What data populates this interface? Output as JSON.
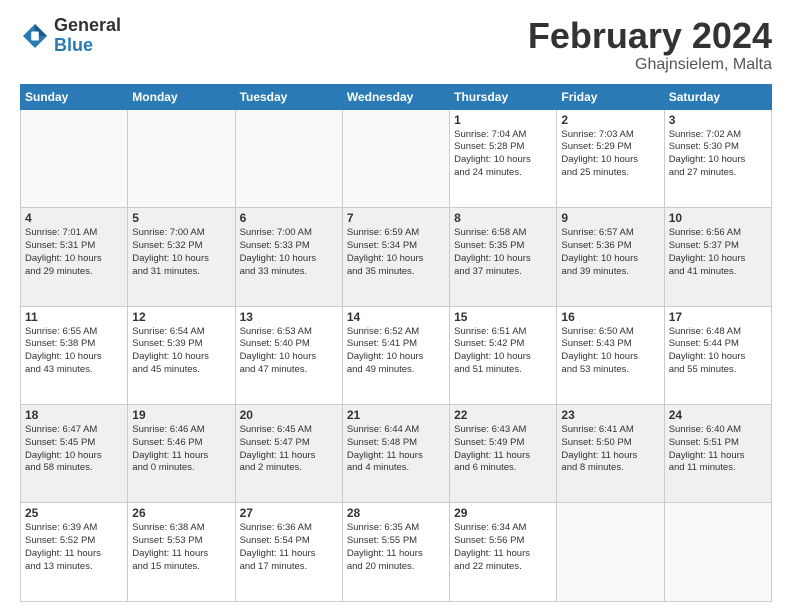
{
  "logo": {
    "general": "General",
    "blue": "Blue"
  },
  "header": {
    "month": "February 2024",
    "location": "Ghajnsielem, Malta"
  },
  "days_of_week": [
    "Sunday",
    "Monday",
    "Tuesday",
    "Wednesday",
    "Thursday",
    "Friday",
    "Saturday"
  ],
  "weeks": [
    [
      {
        "day": "",
        "info": ""
      },
      {
        "day": "",
        "info": ""
      },
      {
        "day": "",
        "info": ""
      },
      {
        "day": "",
        "info": ""
      },
      {
        "day": "1",
        "info": "Sunrise: 7:04 AM\nSunset: 5:28 PM\nDaylight: 10 hours\nand 24 minutes."
      },
      {
        "day": "2",
        "info": "Sunrise: 7:03 AM\nSunset: 5:29 PM\nDaylight: 10 hours\nand 25 minutes."
      },
      {
        "day": "3",
        "info": "Sunrise: 7:02 AM\nSunset: 5:30 PM\nDaylight: 10 hours\nand 27 minutes."
      }
    ],
    [
      {
        "day": "4",
        "info": "Sunrise: 7:01 AM\nSunset: 5:31 PM\nDaylight: 10 hours\nand 29 minutes."
      },
      {
        "day": "5",
        "info": "Sunrise: 7:00 AM\nSunset: 5:32 PM\nDaylight: 10 hours\nand 31 minutes."
      },
      {
        "day": "6",
        "info": "Sunrise: 7:00 AM\nSunset: 5:33 PM\nDaylight: 10 hours\nand 33 minutes."
      },
      {
        "day": "7",
        "info": "Sunrise: 6:59 AM\nSunset: 5:34 PM\nDaylight: 10 hours\nand 35 minutes."
      },
      {
        "day": "8",
        "info": "Sunrise: 6:58 AM\nSunset: 5:35 PM\nDaylight: 10 hours\nand 37 minutes."
      },
      {
        "day": "9",
        "info": "Sunrise: 6:57 AM\nSunset: 5:36 PM\nDaylight: 10 hours\nand 39 minutes."
      },
      {
        "day": "10",
        "info": "Sunrise: 6:56 AM\nSunset: 5:37 PM\nDaylight: 10 hours\nand 41 minutes."
      }
    ],
    [
      {
        "day": "11",
        "info": "Sunrise: 6:55 AM\nSunset: 5:38 PM\nDaylight: 10 hours\nand 43 minutes."
      },
      {
        "day": "12",
        "info": "Sunrise: 6:54 AM\nSunset: 5:39 PM\nDaylight: 10 hours\nand 45 minutes."
      },
      {
        "day": "13",
        "info": "Sunrise: 6:53 AM\nSunset: 5:40 PM\nDaylight: 10 hours\nand 47 minutes."
      },
      {
        "day": "14",
        "info": "Sunrise: 6:52 AM\nSunset: 5:41 PM\nDaylight: 10 hours\nand 49 minutes."
      },
      {
        "day": "15",
        "info": "Sunrise: 6:51 AM\nSunset: 5:42 PM\nDaylight: 10 hours\nand 51 minutes."
      },
      {
        "day": "16",
        "info": "Sunrise: 6:50 AM\nSunset: 5:43 PM\nDaylight: 10 hours\nand 53 minutes."
      },
      {
        "day": "17",
        "info": "Sunrise: 6:48 AM\nSunset: 5:44 PM\nDaylight: 10 hours\nand 55 minutes."
      }
    ],
    [
      {
        "day": "18",
        "info": "Sunrise: 6:47 AM\nSunset: 5:45 PM\nDaylight: 10 hours\nand 58 minutes."
      },
      {
        "day": "19",
        "info": "Sunrise: 6:46 AM\nSunset: 5:46 PM\nDaylight: 11 hours\nand 0 minutes."
      },
      {
        "day": "20",
        "info": "Sunrise: 6:45 AM\nSunset: 5:47 PM\nDaylight: 11 hours\nand 2 minutes."
      },
      {
        "day": "21",
        "info": "Sunrise: 6:44 AM\nSunset: 5:48 PM\nDaylight: 11 hours\nand 4 minutes."
      },
      {
        "day": "22",
        "info": "Sunrise: 6:43 AM\nSunset: 5:49 PM\nDaylight: 11 hours\nand 6 minutes."
      },
      {
        "day": "23",
        "info": "Sunrise: 6:41 AM\nSunset: 5:50 PM\nDaylight: 11 hours\nand 8 minutes."
      },
      {
        "day": "24",
        "info": "Sunrise: 6:40 AM\nSunset: 5:51 PM\nDaylight: 11 hours\nand 11 minutes."
      }
    ],
    [
      {
        "day": "25",
        "info": "Sunrise: 6:39 AM\nSunset: 5:52 PM\nDaylight: 11 hours\nand 13 minutes."
      },
      {
        "day": "26",
        "info": "Sunrise: 6:38 AM\nSunset: 5:53 PM\nDaylight: 11 hours\nand 15 minutes."
      },
      {
        "day": "27",
        "info": "Sunrise: 6:36 AM\nSunset: 5:54 PM\nDaylight: 11 hours\nand 17 minutes."
      },
      {
        "day": "28",
        "info": "Sunrise: 6:35 AM\nSunset: 5:55 PM\nDaylight: 11 hours\nand 20 minutes."
      },
      {
        "day": "29",
        "info": "Sunrise: 6:34 AM\nSunset: 5:56 PM\nDaylight: 11 hours\nand 22 minutes."
      },
      {
        "day": "",
        "info": ""
      },
      {
        "day": "",
        "info": ""
      }
    ]
  ]
}
